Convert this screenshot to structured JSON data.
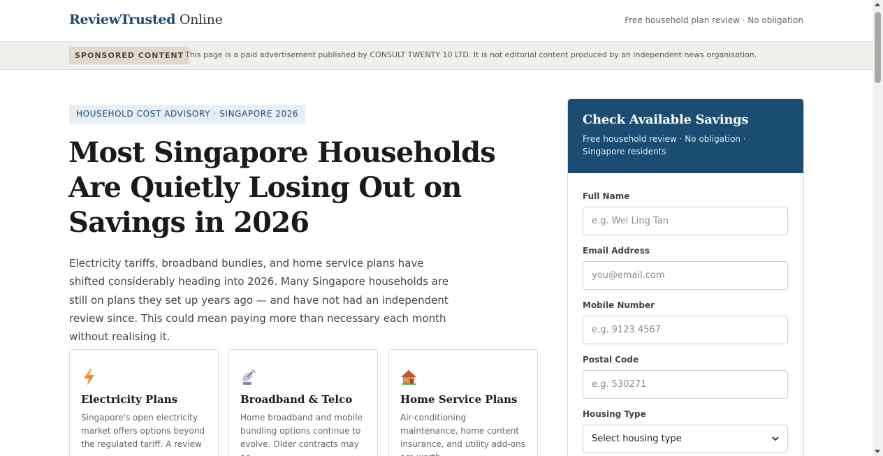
{
  "header": {
    "brand": "ReviewTrusted",
    "brand_suffix": "Online",
    "tagline": "Free household plan review · No obligation"
  },
  "sponsor": {
    "badge": "SPONSORED CONTENT",
    "disclosure": "This page is a paid advertisement published by CONSULT TWENTY 10 LTD. It is not editorial content produced by an independent news organisation."
  },
  "article": {
    "kicker": "HOUSEHOLD COST ADVISORY · SINGAPORE 2026",
    "headline": "Most Singapore Households Are Quietly Losing Out on Savings in 2026",
    "lede": "Electricity tariffs, broadband bundles, and home service plans have shifted considerably heading into 2026. Many Singapore households are still on plans they set up years ago — and have not had an independent review since. This could mean paying more than necessary each month without realising it."
  },
  "cards": [
    {
      "icon": "lightning-icon",
      "title": "Electricity Plans",
      "body": "Singapore's open electricity market offers options beyond the regulated tariff. A review"
    },
    {
      "icon": "satellite-dish-icon",
      "title": "Broadband & Telco",
      "body": "Home broadband and mobile bundling options continue to evolve. Older contracts may no"
    },
    {
      "icon": "house-icon",
      "title": "Home Service Plans",
      "body": "Air-conditioning maintenance, home content insurance, and utility add-ons are worth"
    }
  ],
  "form": {
    "title": "Check Available Savings",
    "subtitle": "Free household review · No obligation · Singapore residents",
    "fields": {
      "full_name": {
        "label": "Full Name",
        "placeholder": "e.g. Wei Ling Tan"
      },
      "email": {
        "label": "Email Address",
        "placeholder": "you@email.com"
      },
      "mobile": {
        "label": "Mobile Number",
        "placeholder": "e.g. 9123 4567"
      },
      "postal": {
        "label": "Postal Code",
        "placeholder": "e.g. 530271"
      },
      "housing": {
        "label": "Housing Type",
        "selected": "Select housing type"
      }
    }
  },
  "colors": {
    "brand_blue": "#1b4d73",
    "sponsor_bar": "#f1efea",
    "kicker_bg": "#e6eef6"
  }
}
